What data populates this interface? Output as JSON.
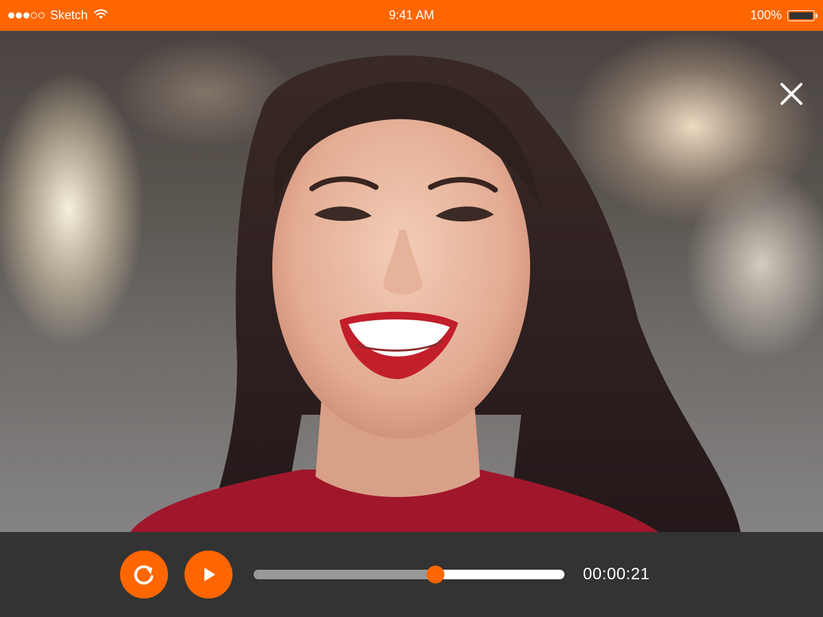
{
  "status_bar": {
    "carrier": "Sketch",
    "time": "9:41 AM",
    "battery_percent": "100%",
    "signal_strength": 3,
    "signal_max": 5,
    "wifi_icon": "wifi-icon",
    "battery_icon": "battery-icon"
  },
  "player": {
    "close_icon": "close-icon",
    "replay_icon": "replay-icon",
    "play_icon": "play-icon",
    "elapsed_time": "00:00:21",
    "progress_percent": 58.5
  },
  "colors": {
    "accent": "#ff6600",
    "controls_bg": "#333333",
    "track": "#ffffff",
    "track_played": "#999999"
  }
}
